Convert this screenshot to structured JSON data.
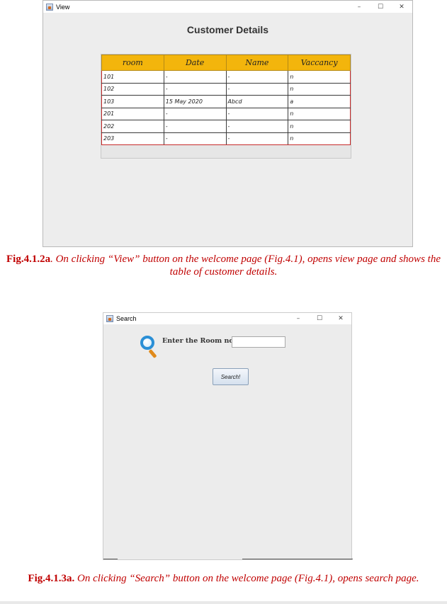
{
  "view_window": {
    "title": "View",
    "controls": {
      "minimize": "–",
      "maximize": "☐",
      "close": "✕"
    },
    "heading": "Customer Details",
    "table": {
      "columns": [
        "room",
        "Date",
        "Name",
        "Vaccancy"
      ],
      "rows": [
        [
          "101",
          "-",
          "-",
          "n"
        ],
        [
          "102",
          "-",
          "-",
          "n"
        ],
        [
          "103",
          "15 May 2020",
          "Abcd",
          "a"
        ],
        [
          "201",
          "-",
          "-",
          "n"
        ],
        [
          "202",
          "-",
          "-",
          "n"
        ],
        [
          "203",
          "-",
          "-",
          "n"
        ]
      ]
    }
  },
  "caption_1": {
    "fig": "Fig.4.1.2a",
    "text": ". On clicking “View” button on the welcome page (Fig.4.1), opens view page and shows the table of customer details."
  },
  "search_window": {
    "title": "Search",
    "controls": {
      "minimize": "–",
      "maximize": "☐",
      "close": "✕"
    },
    "room_label": "Enter the Room no. :",
    "room_input": {
      "value": "",
      "placeholder": ""
    },
    "search_button": "Search!",
    "icon": "search-icon"
  },
  "caption_2": {
    "fig": "Fig.4.1.3a.",
    "text": " On clicking “Search” button on the welcome page (Fig.4.1), opens search page."
  },
  "colors": {
    "header_bg": "#f3b50c",
    "caption": "#c00000",
    "accent_border": "#c62a2a"
  }
}
